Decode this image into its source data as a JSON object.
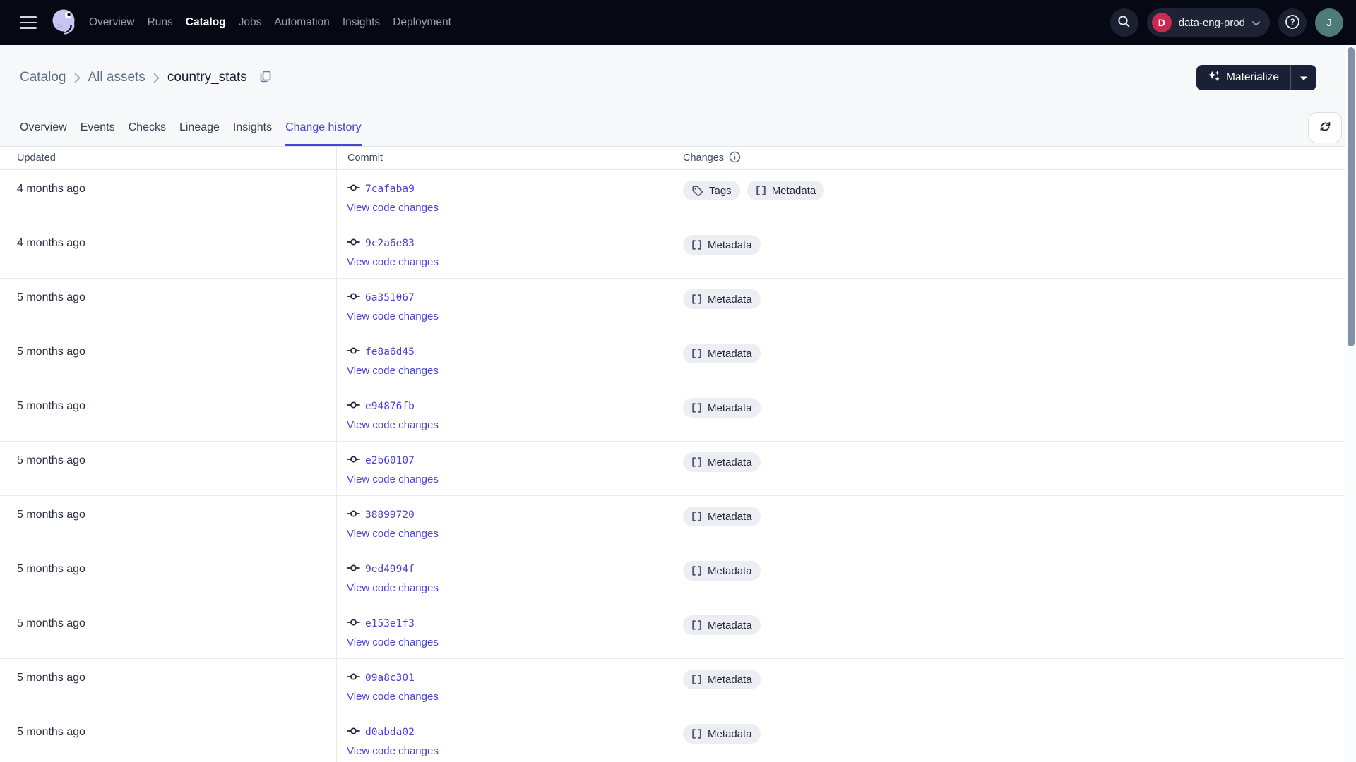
{
  "topnav": {
    "menu_items": [
      {
        "label": "Overview",
        "active": false
      },
      {
        "label": "Runs",
        "active": false
      },
      {
        "label": "Catalog",
        "active": true
      },
      {
        "label": "Jobs",
        "active": false
      },
      {
        "label": "Automation",
        "active": false
      },
      {
        "label": "Insights",
        "active": false
      },
      {
        "label": "Deployment",
        "active": false
      }
    ],
    "deployment_switcher": {
      "initial": "D",
      "label": "data-eng-prod"
    },
    "user_initial": "J"
  },
  "breadcrumb": {
    "items": [
      {
        "label": "Catalog"
      },
      {
        "label": "All assets"
      }
    ],
    "current": "country_stats"
  },
  "actions": {
    "materialize_label": "Materialize"
  },
  "tabs": [
    {
      "label": "Overview",
      "active": false
    },
    {
      "label": "Events",
      "active": false
    },
    {
      "label": "Checks",
      "active": false
    },
    {
      "label": "Lineage",
      "active": false
    },
    {
      "label": "Insights",
      "active": false
    },
    {
      "label": "Change history",
      "active": true
    }
  ],
  "table": {
    "columns": [
      {
        "label": "Updated"
      },
      {
        "label": "Commit"
      },
      {
        "label": "Changes",
        "has_info_icon": true
      }
    ],
    "rows": [
      {
        "updated": "4 months ago",
        "commit": "7cafaba9",
        "view_link": "View code changes",
        "changes": [
          {
            "label": "Tags",
            "icon": "tag-icon"
          },
          {
            "label": "Metadata",
            "icon": "brackets-icon"
          }
        ]
      },
      {
        "updated": "4 months ago",
        "commit": "9c2a6e83",
        "view_link": "View code changes",
        "changes": [
          {
            "label": "Metadata",
            "icon": "brackets-icon"
          }
        ]
      },
      {
        "updated": "5 months ago",
        "commit": "6a351067",
        "view_link": "View code changes",
        "changes": [
          {
            "label": "Metadata",
            "icon": "brackets-icon"
          }
        ],
        "bottom_divider": false
      },
      {
        "updated": "5 months ago",
        "commit": "fe8a6d45",
        "view_link": "View code changes",
        "changes": [
          {
            "label": "Metadata",
            "icon": "brackets-icon"
          }
        ]
      },
      {
        "updated": "5 months ago",
        "commit": "e94876fb",
        "view_link": "View code changes",
        "changes": [
          {
            "label": "Metadata",
            "icon": "brackets-icon"
          }
        ]
      },
      {
        "updated": "5 months ago",
        "commit": "e2b60107",
        "view_link": "View code changes",
        "changes": [
          {
            "label": "Metadata",
            "icon": "brackets-icon"
          }
        ]
      },
      {
        "updated": "5 months ago",
        "commit": "38899720",
        "view_link": "View code changes",
        "changes": [
          {
            "label": "Metadata",
            "icon": "brackets-icon"
          }
        ]
      },
      {
        "updated": "5 months ago",
        "commit": "9ed4994f",
        "view_link": "View code changes",
        "changes": [
          {
            "label": "Metadata",
            "icon": "brackets-icon"
          }
        ],
        "bottom_divider": false
      },
      {
        "updated": "5 months ago",
        "commit": "e153e1f3",
        "view_link": "View code changes",
        "changes": [
          {
            "label": "Metadata",
            "icon": "brackets-icon"
          }
        ]
      },
      {
        "updated": "5 months ago",
        "commit": "09a8c301",
        "view_link": "View code changes",
        "changes": [
          {
            "label": "Metadata",
            "icon": "brackets-icon"
          }
        ]
      },
      {
        "updated": "5 months ago",
        "commit": "d0abda02",
        "view_link": "View code changes",
        "changes": [
          {
            "label": "Metadata",
            "icon": "brackets-icon"
          }
        ]
      }
    ]
  },
  "icons": {
    "hamburger-icon": "menu",
    "dagster-logo": "octopus mascot",
    "search-icon": "magnifier",
    "chevron-down-icon": "caret",
    "help-icon": "question mark in circle",
    "copy-icon": "duplicate squares",
    "sparkle-icon": "stars",
    "refresh-icon": "sync arrows",
    "info-icon": "i in circle",
    "commit-icon": "git commit",
    "tag-icon": "tag outline",
    "brackets-icon": "square brackets"
  },
  "colors": {
    "accent": "#4A43D9",
    "nav_bg": "#060914",
    "deployment_badge_bg": "#CB2950",
    "avatar_bg": "#4E7B78",
    "chip_bg": "#ECEEF3",
    "header_band_bg": "#F7F8F9"
  }
}
